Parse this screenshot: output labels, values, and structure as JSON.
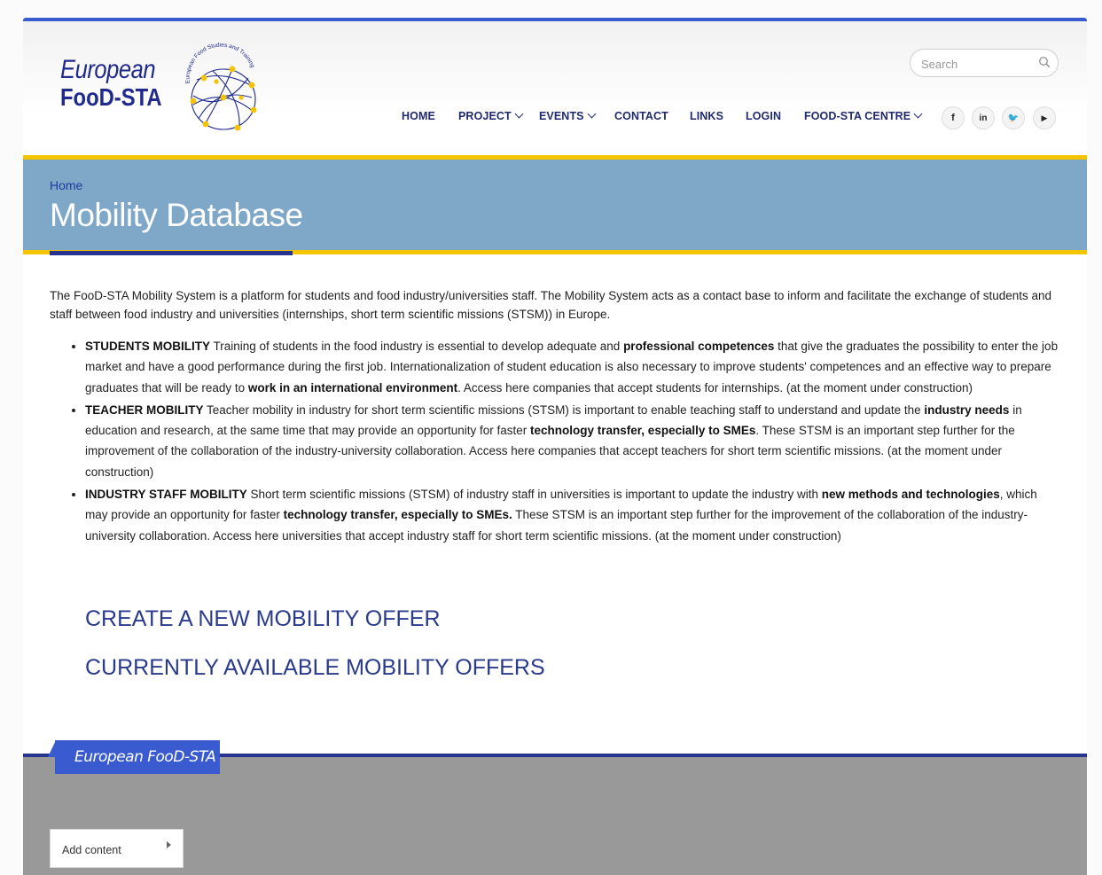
{
  "header": {
    "logo_line1": "European",
    "logo_line2": "FooD-STA",
    "logo_arc_text": "European Food Studies and Training Alliance",
    "search_placeholder": "Search",
    "nav": [
      {
        "label": "HOME",
        "has_dropdown": false
      },
      {
        "label": "PROJECT",
        "has_dropdown": true
      },
      {
        "label": "EVENTS",
        "has_dropdown": true
      },
      {
        "label": "CONTACT",
        "has_dropdown": false
      },
      {
        "label": "LINKS",
        "has_dropdown": false
      },
      {
        "label": "LOGIN",
        "has_dropdown": false
      },
      {
        "label": "FOOD-STA CENTRE",
        "has_dropdown": true
      }
    ],
    "social": [
      {
        "icon": "facebook-icon",
        "glyph": "f"
      },
      {
        "icon": "linkedin-icon",
        "glyph": "in"
      },
      {
        "icon": "twitter-icon",
        "glyph": "🐦"
      },
      {
        "icon": "youtube-icon",
        "glyph": "▶"
      }
    ]
  },
  "banner": {
    "breadcrumb": "Home",
    "title": "Mobility Database"
  },
  "content": {
    "intro": "The FooD-STA Mobility System is a platform for students and food industry/universities staff. The Mobility System acts as a contact base to inform and facilitate the exchange of students and staff between food industry and universities (internships, short term scientific missions (STSM)) in Europe.",
    "items": [
      {
        "heading": "STUDENTS MOBILITY",
        "t1": " Training of students in the food industry is essential to develop adequate and ",
        "b1": "professional competences",
        "t2": " that give the graduates the possibility to enter the job market and have a good performance during the first job. Internationalization of student education is also necessary to improve students' competences and an effective way to prepare graduates that will be ready to ",
        "b2": "work in an international environment",
        "t3": ". Access here companies that accept students for internships. (at the moment under construction)"
      },
      {
        "heading": "TEACHER MOBILITY",
        "t1": " Teacher mobility in industry for short term scientific missions (STSM) is important to enable teaching staff to understand and update the ",
        "b1": "industry needs",
        "t2": " in education and research, at the same time that may provide an opportunity for faster ",
        "b2": "technology transfer, especially to SMEs",
        "t3": ". These STSM is an important step further for the improvement of the collaboration of the industry-university collaboration. Access here companies that accept teachers for short term scientific missions. (at the moment under construction)"
      },
      {
        "heading": "INDUSTRY STAFF MOBILITY",
        "t1": " Short term scientific missions (STSM) of industry staff in universities is important to update the industry with ",
        "b1": "new methods and technologies",
        "t2": ", which may provide an opportunity for faster ",
        "b2": "technology transfer, especially to SMEs.",
        "t3": " These STSM is an important step further for the improvement of the collaboration of the industry-university collaboration. Access here universities that accept industry staff for short term scientific missions. (at the moment under construction)"
      }
    ],
    "link_create": "CREATE A NEW MOBILITY OFFER",
    "link_current": "CURRENTLY AVAILABLE MOBILITY OFFERS"
  },
  "footer": {
    "tab_label": "European FooD-STA",
    "add_content_label": "Add content"
  },
  "colors": {
    "accent_blue": "#3a5bd0",
    "navy": "#26348e",
    "banner": "#7fa7c8",
    "yellow": "#f5c400",
    "footer_gray": "#999999"
  }
}
